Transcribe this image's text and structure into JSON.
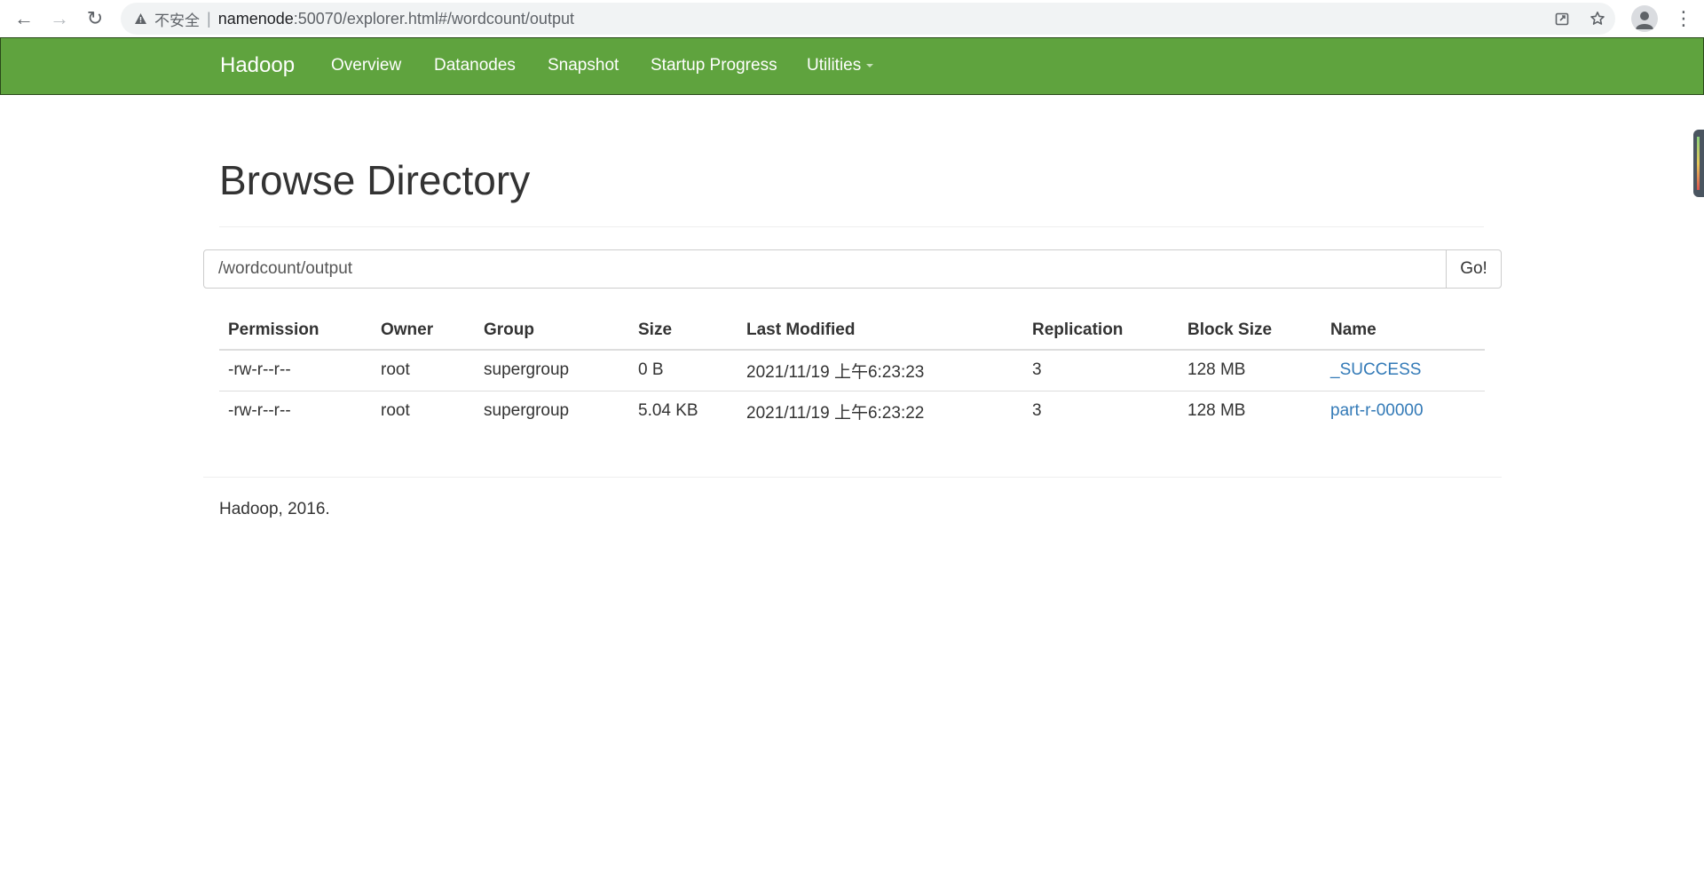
{
  "browser": {
    "back_icon": "←",
    "forward_icon": "→",
    "reload_icon": "↻",
    "security_label": "不安全",
    "separator": "|",
    "url_host": "namenode",
    "url_path": ":50070/explorer.html#/wordcount/output",
    "menu_icon": "⋮"
  },
  "navbar": {
    "brand": "Hadoop",
    "items": [
      "Overview",
      "Datanodes",
      "Snapshot",
      "Startup Progress",
      "Utilities"
    ]
  },
  "page": {
    "title": "Browse Directory",
    "path_value": "/wordcount/output",
    "go_label": "Go!"
  },
  "table": {
    "headers": [
      "Permission",
      "Owner",
      "Group",
      "Size",
      "Last Modified",
      "Replication",
      "Block Size",
      "Name"
    ],
    "rows": [
      {
        "permission": "-rw-r--r--",
        "owner": "root",
        "group": "supergroup",
        "size": "0 B",
        "modified": "2021/11/19 上午6:23:23",
        "replication": "3",
        "block_size": "128 MB",
        "name": "_SUCCESS"
      },
      {
        "permission": "-rw-r--r--",
        "owner": "root",
        "group": "supergroup",
        "size": "5.04 KB",
        "modified": "2021/11/19 上午6:23:22",
        "replication": "3",
        "block_size": "128 MB",
        "name": "part-r-00000"
      }
    ]
  },
  "footer": {
    "text": "Hadoop, 2016."
  }
}
